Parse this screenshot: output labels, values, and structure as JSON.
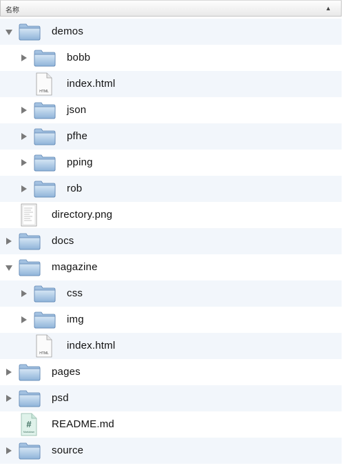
{
  "header": {
    "column_label": "名称",
    "sort_indicator": "▲"
  },
  "rows": [
    {
      "name": "demos",
      "type": "folder",
      "level": 0,
      "disclosure": "expanded"
    },
    {
      "name": "bobb",
      "type": "folder",
      "level": 1,
      "disclosure": "collapsed"
    },
    {
      "name": "index.html",
      "type": "html",
      "level": 1,
      "disclosure": "none"
    },
    {
      "name": "json",
      "type": "folder",
      "level": 1,
      "disclosure": "collapsed"
    },
    {
      "name": "pfhe",
      "type": "folder",
      "level": 1,
      "disclosure": "collapsed"
    },
    {
      "name": "pping",
      "type": "folder",
      "level": 1,
      "disclosure": "collapsed"
    },
    {
      "name": "rob",
      "type": "folder",
      "level": 1,
      "disclosure": "collapsed"
    },
    {
      "name": "directory.png",
      "type": "image",
      "level": 0,
      "disclosure": "none"
    },
    {
      "name": "docs",
      "type": "folder",
      "level": 0,
      "disclosure": "collapsed"
    },
    {
      "name": "magazine",
      "type": "folder",
      "level": 0,
      "disclosure": "expanded"
    },
    {
      "name": "css",
      "type": "folder",
      "level": 1,
      "disclosure": "collapsed"
    },
    {
      "name": "img",
      "type": "folder",
      "level": 1,
      "disclosure": "collapsed"
    },
    {
      "name": "index.html",
      "type": "html",
      "level": 1,
      "disclosure": "none"
    },
    {
      "name": "pages",
      "type": "folder",
      "level": 0,
      "disclosure": "collapsed"
    },
    {
      "name": "psd",
      "type": "folder",
      "level": 0,
      "disclosure": "collapsed"
    },
    {
      "name": "README.md",
      "type": "markdown",
      "level": 0,
      "disclosure": "none"
    },
    {
      "name": "source",
      "type": "folder",
      "level": 0,
      "disclosure": "collapsed"
    }
  ],
  "icon_labels": {
    "html": "HTML",
    "markdown": "#",
    "markdown_caption": "Markdown"
  },
  "colors": {
    "alt_row": "#f2f6fb",
    "folder_light": "#bcd3ea",
    "folder_dark": "#7ea6cf",
    "disclosure": "#7a7a7a"
  }
}
